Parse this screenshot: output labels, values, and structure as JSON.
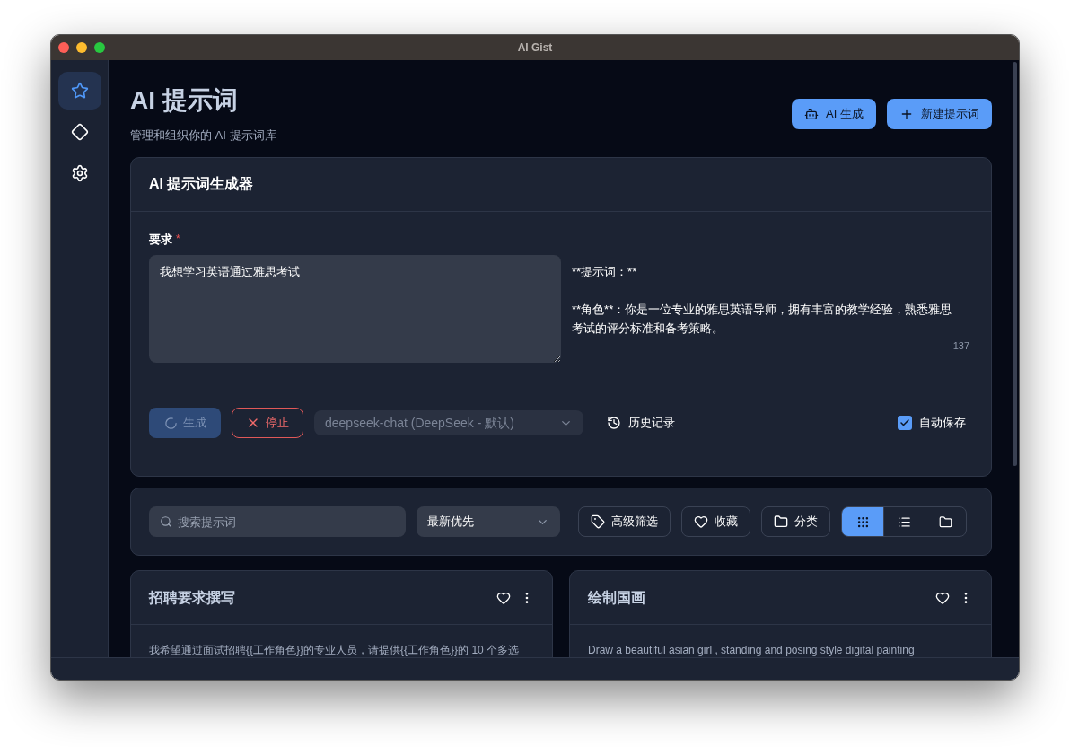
{
  "window": {
    "title": "AI Gist"
  },
  "sidebar": {
    "items": [
      {
        "selected": true
      },
      {
        "selected": false
      },
      {
        "selected": false
      }
    ]
  },
  "header": {
    "title": "AI 提示词",
    "subtitle": "管理和组织你的 AI 提示词库",
    "buttons": [
      {
        "label": "AI 生成"
      },
      {
        "label": "新建提示词"
      }
    ]
  },
  "generator": {
    "title": "AI 提示词生成器",
    "field_label": "要求",
    "required_mark": "*",
    "requirement_value": "我想学习英语通过雅思考试",
    "output_lines": [
      "**提示词：**",
      "**角色**：你是一位专业的雅思英语导师，拥有丰富的教学经验，熟悉雅思考试的评分标准和备考策略。"
    ],
    "char_count": "137",
    "generate_button": {
      "label": "生成",
      "loading": true
    },
    "stop_button": {
      "label": "停止"
    },
    "model_select": {
      "value": "deepseek-chat (DeepSeek - 默认)",
      "disabled": true
    },
    "history_button": {
      "label": "历史记录"
    },
    "auto_save": {
      "label": "自动保存",
      "checked": true
    }
  },
  "toolbar": {
    "search": {
      "placeholder": "搜索提示词"
    },
    "sort": {
      "value": "最新优先"
    },
    "filters": [
      {
        "label": "高级筛选"
      },
      {
        "label": "收藏"
      },
      {
        "label": "分类"
      }
    ],
    "views": [
      {
        "selected": true
      },
      {
        "selected": false
      },
      {
        "selected": false
      }
    ]
  },
  "cards": [
    {
      "title": "招聘要求撰写",
      "favorite": false,
      "body": "我希望通过面试招聘{{工作角色}}的专业人员，请提供{{工作角色}}的 10 个多选"
    },
    {
      "title": "绘制国画",
      "favorite": false,
      "body": "Draw a beautiful asian girl , standing and posing style digital painting"
    }
  ]
}
